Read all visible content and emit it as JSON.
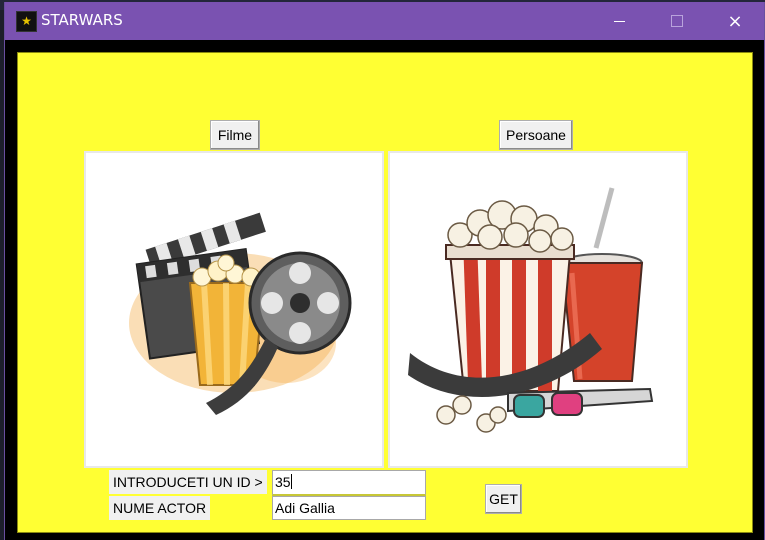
{
  "window": {
    "title": "STARWARS",
    "icon": "starwars-app-icon",
    "controls": {
      "minimize": "minimize-icon",
      "maximize": "maximize-icon",
      "close": "×"
    }
  },
  "buttons": {
    "films": "Filme",
    "people": "Persoane",
    "get": "GET"
  },
  "images": {
    "left": "film-clapperboard-popcorn-reel",
    "right": "popcorn-drink-3d-glasses"
  },
  "form": {
    "id_label": "INTRODUCETI UN ID >",
    "id_value": "35",
    "actor_label": "NUME ACTOR",
    "actor_value": "Adi Gallia"
  },
  "colors": {
    "titlebar": "#7a52b1",
    "client_bg": "#ffff33"
  }
}
